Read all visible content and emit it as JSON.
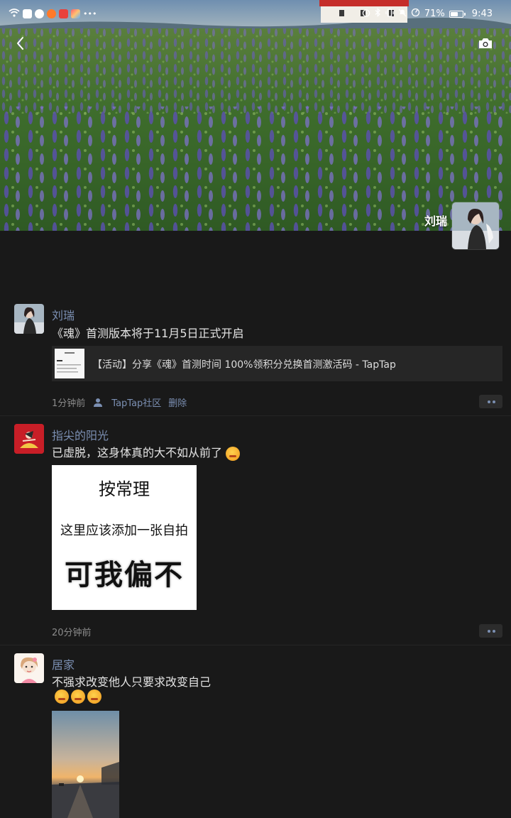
{
  "status_bar": {
    "battery": "71%",
    "battery_level": 0.71,
    "time": "9:43"
  },
  "cover": {
    "back_icon": "chevron-left-icon",
    "camera_icon": "camera-icon"
  },
  "profile": {
    "name": "刘瑞"
  },
  "posts": [
    {
      "author": "刘瑞",
      "text": "《魂》首测版本将于11月5日正式开启",
      "share_title": "【活动】分享《魂》首测时间 100%领积分兑换首测激活码 - TapTap",
      "time": "1分钟前",
      "source": "TapTap社区",
      "delete_label": "删除"
    },
    {
      "author": "指尖的阳光",
      "text": "已虚脱，这身体真的大不如从前了",
      "image_lines": [
        "按常理",
        "这里应该添加一张自拍",
        "可我偏不"
      ],
      "time": "20分钟前"
    },
    {
      "author": "居家",
      "text": "不强求改变他人只要求改变自己"
    }
  ],
  "colors": {
    "background": "#191919",
    "link": "#7b8fb2",
    "text": "#e4e4e4",
    "meta": "#8b8b8b"
  }
}
